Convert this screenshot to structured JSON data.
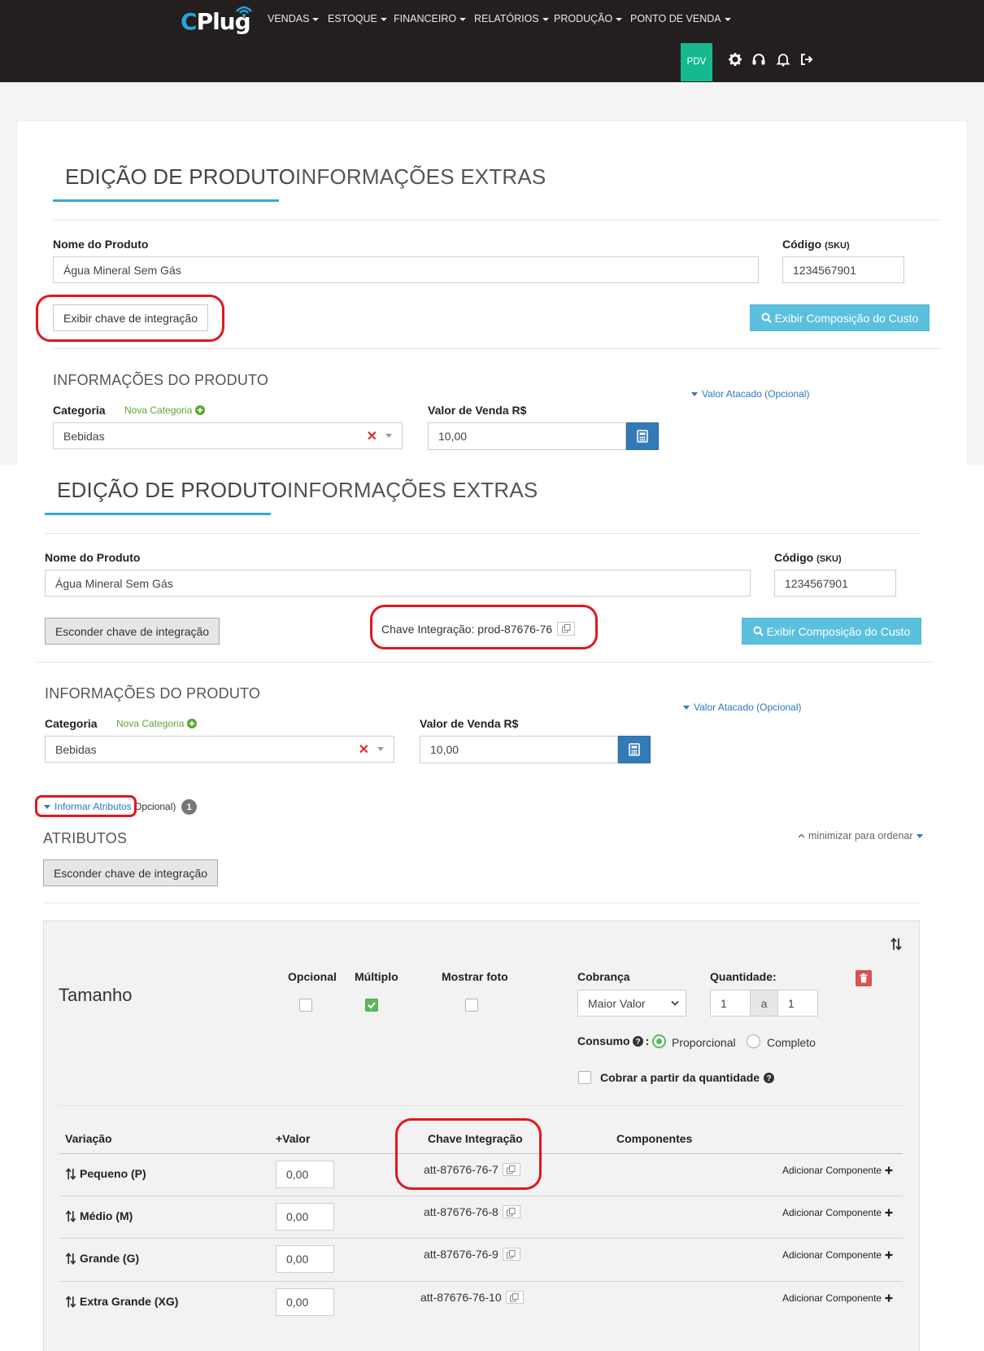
{
  "nav": {
    "logo": "Plug",
    "logo_c": "C",
    "menu": [
      "VENDAS",
      "ESTOQUE",
      "FINANCEIRO",
      "RELATÓRIOS",
      "PRODUÇÃO",
      "PONTO DE VENDA"
    ],
    "pdv": "PDV",
    "icons": [
      "gear-icon",
      "headset-icon",
      "bell-icon",
      "sign-out-icon"
    ]
  },
  "top": {
    "tab_active": "EDIÇÃO DE PRODUTO",
    "tab_inactive": "INFORMAÇÕES EXTRAS",
    "product_name_label": "Nome do Produto",
    "product_name": "Água Mineral Sem Gás",
    "sku_label": "Código",
    "sku_small": "(SKU)",
    "sku": "1234567901",
    "show_key_button": "Exibir chave de integração",
    "cost_button": "Exibir Composição do Custo",
    "info_title": "INFORMAÇÕES DO PRODUTO",
    "wholesale_link": "Valor Atacado (Opcional)",
    "category_label": "Categoria",
    "new_category": "Nova Categoria",
    "category": "Bebidas",
    "price_label": "Valor de Venda R$",
    "price": "10,00"
  },
  "bottom": {
    "tab_active": "EDIÇÃO DE PRODUTO",
    "tab_inactive": "INFORMAÇÕES EXTRAS",
    "product_name_label": "Nome do Produto",
    "product_name": "Água Mineral Sem Gás",
    "sku_label": "Código",
    "sku_small": "(SKU)",
    "sku": "1234567901",
    "hide_key_button": "Esconder chave de integração",
    "integration_key": "Chave Integração: prod-87676-76",
    "cost_button": "Exibir Composição do Custo",
    "info_title": "INFORMAÇÕES DO PRODUTO",
    "wholesale_link": "Valor Atacado (Opcional)",
    "category_label": "Categoria",
    "new_category": "Nova Categoria",
    "category": "Bebidas",
    "price_label": "Valor de Venda R$",
    "price": "10,00",
    "attributes_link": "Informar Atributos",
    "attributes_optional": "Opcional)",
    "attributes_count": "1",
    "attributes_title": "ATRIBUTOS",
    "minimize_link": "minimizar para ordenar",
    "hide_key_button_2": "Esconder chave de integração"
  },
  "attribute": {
    "name": "Tamanho",
    "col_optional": "Opcional",
    "col_multiple": "Múltiplo",
    "col_show_photo": "Mostrar foto",
    "col_charge": "Cobrança",
    "col_quantity": "Quantidade:",
    "charge_value": "Maior Valor",
    "qty_min": "1",
    "qty_sep": "a",
    "qty_max": "1",
    "optional_checked": false,
    "multiple_checked": true,
    "show_photo_checked": false,
    "consumption_label": "Consumo",
    "consumption_options": [
      "Proporcional",
      "Completo"
    ],
    "consumption_selected": "Proporcional",
    "charge_from_qty": "Cobrar a partir da quantidade",
    "table_headers": [
      "Variação",
      "+Valor",
      "Chave Integração",
      "Componentes"
    ],
    "rows": [
      {
        "name": "Pequeno (P)",
        "value": "0,00",
        "key": "att-87676-76-7",
        "action": "Adicionar Componente"
      },
      {
        "name": "Médio (M)",
        "value": "0,00",
        "key": "att-87676-76-8",
        "action": "Adicionar Componente"
      },
      {
        "name": "Grande (G)",
        "value": "0,00",
        "key": "att-87676-76-9",
        "action": "Adicionar Componente"
      },
      {
        "name": "Extra Grande (XG)",
        "value": "0,00",
        "key": "att-87676-76-10",
        "action": "Adicionar Componente"
      }
    ]
  },
  "colors": {
    "navbar": "#231f1f",
    "pdv": "#16b98f",
    "accent": "#3aa6dc",
    "info_button": "#5bc0de",
    "highlight_ring": "#e0181d"
  }
}
